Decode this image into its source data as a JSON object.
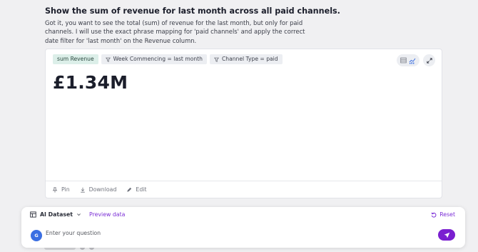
{
  "conversation": {
    "question": "Show the sum of revenue for last month across all paid channels.",
    "answer": "Got it, you want to see the total (sum) of revenue for the last month, but only for paid channels. I will use the exact phrase mapping for 'paid channels' and apply the correct date filter for 'last month' on the Revenue column."
  },
  "result_card": {
    "chips": [
      {
        "label": "sum Revenue",
        "kind": "measure"
      },
      {
        "label": "Week Commencing = last month",
        "kind": "filter"
      },
      {
        "label": "Channel Type = paid",
        "kind": "filter"
      }
    ],
    "kpi_value": "£1.34M",
    "actions": {
      "pin": "Pin",
      "download": "Download",
      "edit": "Edit"
    }
  },
  "input_panel": {
    "dataset": "AI Dataset",
    "preview_link": "Preview data",
    "reset": "Reset",
    "avatar_initial": "G",
    "placeholder": "Enter your question"
  },
  "colors": {
    "accent": "#7a1fd0",
    "measure_chip": "#dcefe9",
    "avatar": "#3b6fe2"
  }
}
